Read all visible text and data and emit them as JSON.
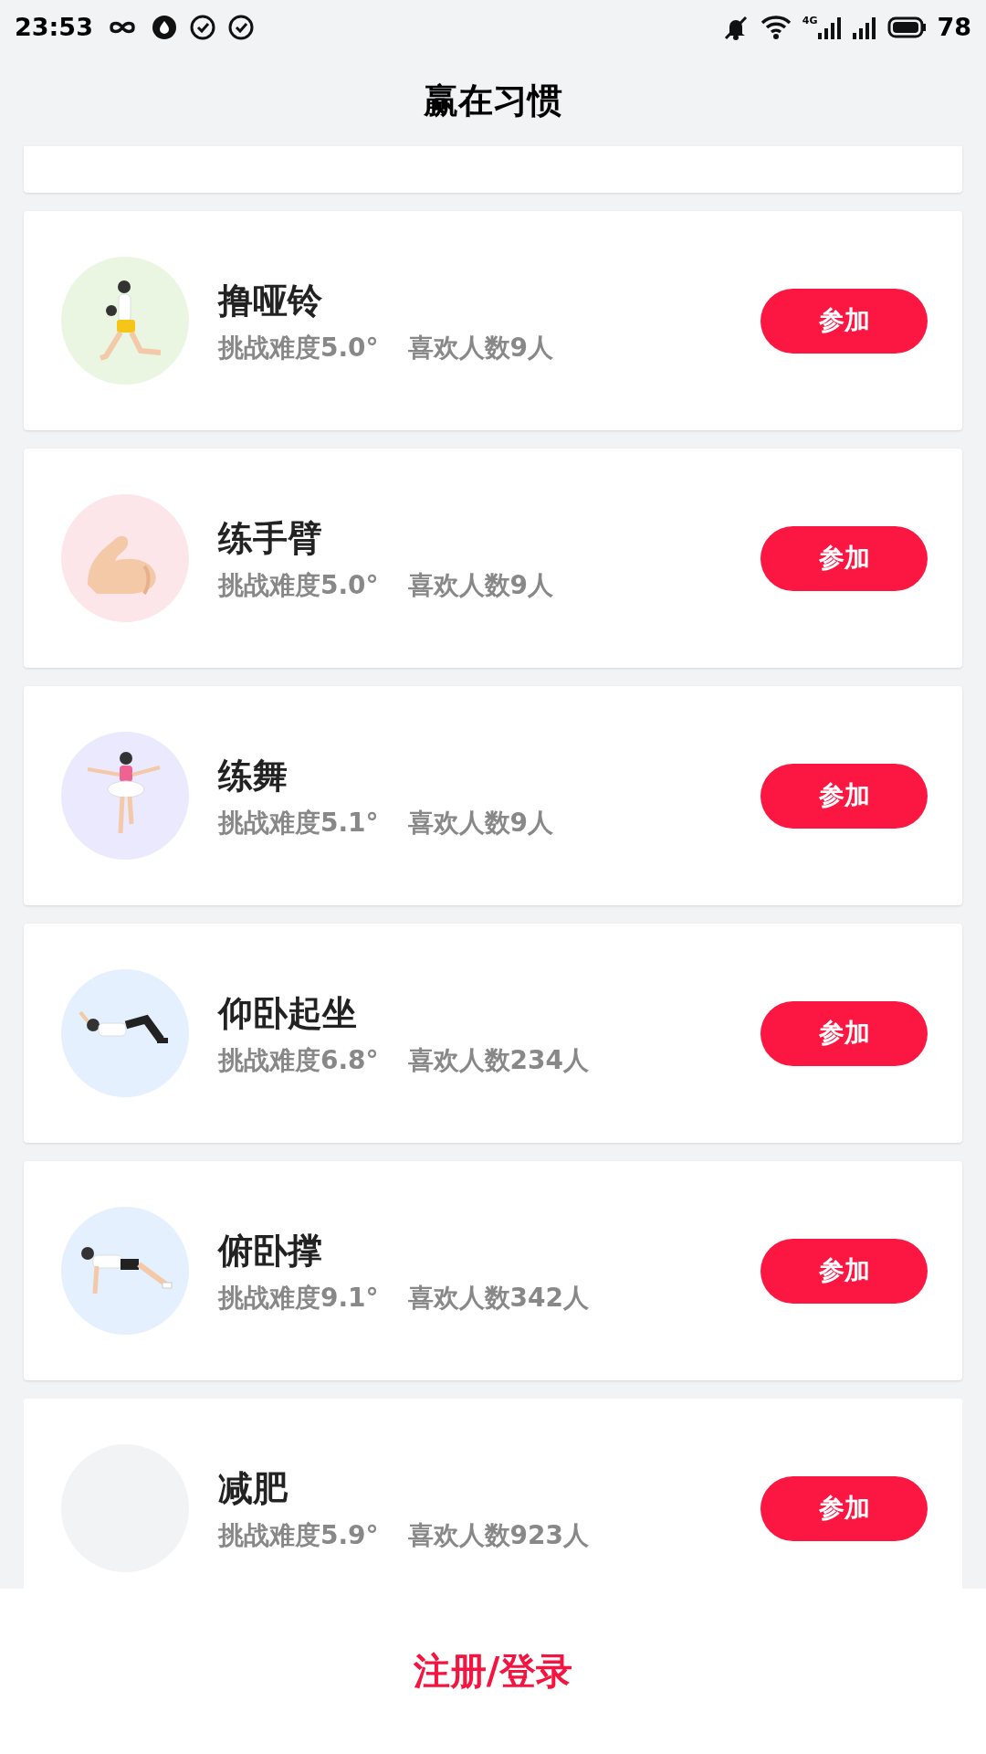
{
  "status_bar": {
    "time": "23:53",
    "network": "4G",
    "battery": "78"
  },
  "header": {
    "title": "赢在习惯"
  },
  "habits": [
    {
      "name": "撸哑铃",
      "difficulty": "挑战难度5.0°",
      "likes": "喜欢人数9人",
      "button": "参加",
      "color": "#eaf6e2"
    },
    {
      "name": "练手臂",
      "difficulty": "挑战难度5.0°",
      "likes": "喜欢人数9人",
      "button": "参加",
      "color": "#fde6ea"
    },
    {
      "name": "练舞",
      "difficulty": "挑战难度5.1°",
      "likes": "喜欢人数9人",
      "button": "参加",
      "color": "#ebe9fd"
    },
    {
      "name": "仰卧起坐",
      "difficulty": "挑战难度6.8°",
      "likes": "喜欢人数234人",
      "button": "参加",
      "color": "#e4f0fd"
    },
    {
      "name": "俯卧撑",
      "difficulty": "挑战难度9.1°",
      "likes": "喜欢人数342人",
      "button": "参加",
      "color": "#e4f0fd"
    },
    {
      "name": "减肥",
      "difficulty": "挑战难度5.9°",
      "likes": "喜欢人数923人",
      "button": "参加",
      "color": "#f2f3f5"
    }
  ],
  "login_bar": {
    "label": "注册/登录"
  }
}
